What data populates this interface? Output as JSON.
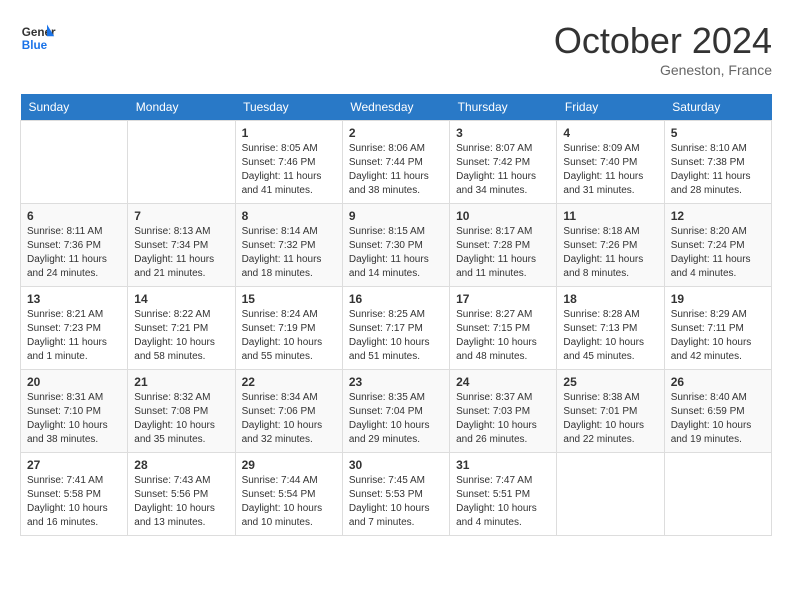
{
  "header": {
    "logo_text_general": "General",
    "logo_text_blue": "Blue",
    "month_title": "October 2024",
    "location": "Geneston, France"
  },
  "weekdays": [
    "Sunday",
    "Monday",
    "Tuesday",
    "Wednesday",
    "Thursday",
    "Friday",
    "Saturday"
  ],
  "weeks": [
    [
      {
        "day": "",
        "info": ""
      },
      {
        "day": "",
        "info": ""
      },
      {
        "day": "1",
        "info": "Sunrise: 8:05 AM\nSunset: 7:46 PM\nDaylight: 11 hours and 41 minutes."
      },
      {
        "day": "2",
        "info": "Sunrise: 8:06 AM\nSunset: 7:44 PM\nDaylight: 11 hours and 38 minutes."
      },
      {
        "day": "3",
        "info": "Sunrise: 8:07 AM\nSunset: 7:42 PM\nDaylight: 11 hours and 34 minutes."
      },
      {
        "day": "4",
        "info": "Sunrise: 8:09 AM\nSunset: 7:40 PM\nDaylight: 11 hours and 31 minutes."
      },
      {
        "day": "5",
        "info": "Sunrise: 8:10 AM\nSunset: 7:38 PM\nDaylight: 11 hours and 28 minutes."
      }
    ],
    [
      {
        "day": "6",
        "info": "Sunrise: 8:11 AM\nSunset: 7:36 PM\nDaylight: 11 hours and 24 minutes."
      },
      {
        "day": "7",
        "info": "Sunrise: 8:13 AM\nSunset: 7:34 PM\nDaylight: 11 hours and 21 minutes."
      },
      {
        "day": "8",
        "info": "Sunrise: 8:14 AM\nSunset: 7:32 PM\nDaylight: 11 hours and 18 minutes."
      },
      {
        "day": "9",
        "info": "Sunrise: 8:15 AM\nSunset: 7:30 PM\nDaylight: 11 hours and 14 minutes."
      },
      {
        "day": "10",
        "info": "Sunrise: 8:17 AM\nSunset: 7:28 PM\nDaylight: 11 hours and 11 minutes."
      },
      {
        "day": "11",
        "info": "Sunrise: 8:18 AM\nSunset: 7:26 PM\nDaylight: 11 hours and 8 minutes."
      },
      {
        "day": "12",
        "info": "Sunrise: 8:20 AM\nSunset: 7:24 PM\nDaylight: 11 hours and 4 minutes."
      }
    ],
    [
      {
        "day": "13",
        "info": "Sunrise: 8:21 AM\nSunset: 7:23 PM\nDaylight: 11 hours and 1 minute."
      },
      {
        "day": "14",
        "info": "Sunrise: 8:22 AM\nSunset: 7:21 PM\nDaylight: 10 hours and 58 minutes."
      },
      {
        "day": "15",
        "info": "Sunrise: 8:24 AM\nSunset: 7:19 PM\nDaylight: 10 hours and 55 minutes."
      },
      {
        "day": "16",
        "info": "Sunrise: 8:25 AM\nSunset: 7:17 PM\nDaylight: 10 hours and 51 minutes."
      },
      {
        "day": "17",
        "info": "Sunrise: 8:27 AM\nSunset: 7:15 PM\nDaylight: 10 hours and 48 minutes."
      },
      {
        "day": "18",
        "info": "Sunrise: 8:28 AM\nSunset: 7:13 PM\nDaylight: 10 hours and 45 minutes."
      },
      {
        "day": "19",
        "info": "Sunrise: 8:29 AM\nSunset: 7:11 PM\nDaylight: 10 hours and 42 minutes."
      }
    ],
    [
      {
        "day": "20",
        "info": "Sunrise: 8:31 AM\nSunset: 7:10 PM\nDaylight: 10 hours and 38 minutes."
      },
      {
        "day": "21",
        "info": "Sunrise: 8:32 AM\nSunset: 7:08 PM\nDaylight: 10 hours and 35 minutes."
      },
      {
        "day": "22",
        "info": "Sunrise: 8:34 AM\nSunset: 7:06 PM\nDaylight: 10 hours and 32 minutes."
      },
      {
        "day": "23",
        "info": "Sunrise: 8:35 AM\nSunset: 7:04 PM\nDaylight: 10 hours and 29 minutes."
      },
      {
        "day": "24",
        "info": "Sunrise: 8:37 AM\nSunset: 7:03 PM\nDaylight: 10 hours and 26 minutes."
      },
      {
        "day": "25",
        "info": "Sunrise: 8:38 AM\nSunset: 7:01 PM\nDaylight: 10 hours and 22 minutes."
      },
      {
        "day": "26",
        "info": "Sunrise: 8:40 AM\nSunset: 6:59 PM\nDaylight: 10 hours and 19 minutes."
      }
    ],
    [
      {
        "day": "27",
        "info": "Sunrise: 7:41 AM\nSunset: 5:58 PM\nDaylight: 10 hours and 16 minutes."
      },
      {
        "day": "28",
        "info": "Sunrise: 7:43 AM\nSunset: 5:56 PM\nDaylight: 10 hours and 13 minutes."
      },
      {
        "day": "29",
        "info": "Sunrise: 7:44 AM\nSunset: 5:54 PM\nDaylight: 10 hours and 10 minutes."
      },
      {
        "day": "30",
        "info": "Sunrise: 7:45 AM\nSunset: 5:53 PM\nDaylight: 10 hours and 7 minutes."
      },
      {
        "day": "31",
        "info": "Sunrise: 7:47 AM\nSunset: 5:51 PM\nDaylight: 10 hours and 4 minutes."
      },
      {
        "day": "",
        "info": ""
      },
      {
        "day": "",
        "info": ""
      }
    ]
  ]
}
